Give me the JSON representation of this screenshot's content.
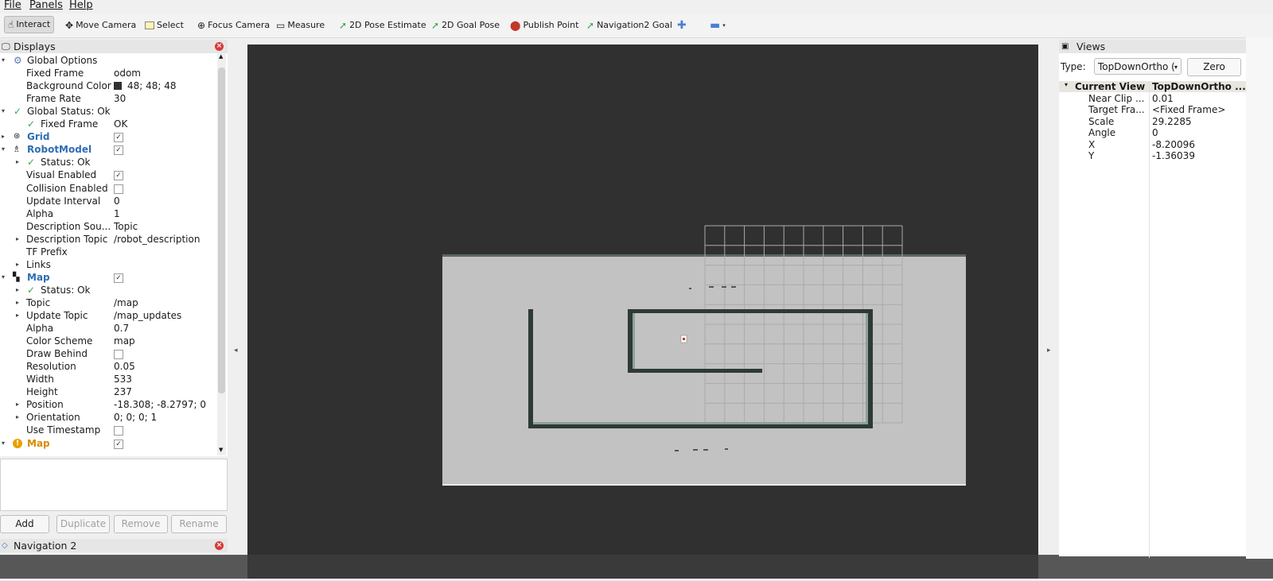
{
  "menu": [
    "File",
    "Panels",
    "Help"
  ],
  "toolbar": {
    "tools": [
      "Interact",
      "Move Camera",
      "Select",
      "Focus Camera",
      "Measure",
      "2D Pose Estimate",
      "2D Goal Pose",
      "Publish Point",
      "Navigation2 Goal"
    ]
  },
  "displays": {
    "title": "Displays",
    "rows": [
      {
        "name": "Global Options",
        "value": ""
      },
      {
        "name": "Fixed Frame",
        "value": "odom"
      },
      {
        "name": "Background Color",
        "value": "48; 48; 48"
      },
      {
        "name": "Frame Rate",
        "value": "30"
      },
      {
        "name": "Global Status: Ok",
        "value": ""
      },
      {
        "name": "Fixed Frame",
        "value": "OK"
      },
      {
        "name": "Grid",
        "value": ""
      },
      {
        "name": "RobotModel",
        "value": ""
      },
      {
        "name": "Status: Ok",
        "value": ""
      },
      {
        "name": "Visual Enabled",
        "value": ""
      },
      {
        "name": "Collision Enabled",
        "value": ""
      },
      {
        "name": "Update Interval",
        "value": "0"
      },
      {
        "name": "Alpha",
        "value": "1"
      },
      {
        "name": "Description Sou...",
        "value": "Topic"
      },
      {
        "name": "Description Topic",
        "value": "/robot_description"
      },
      {
        "name": "TF Prefix",
        "value": ""
      },
      {
        "name": "Links",
        "value": ""
      },
      {
        "name": "Map",
        "value": ""
      },
      {
        "name": "Status: Ok",
        "value": ""
      },
      {
        "name": "Topic",
        "value": "/map"
      },
      {
        "name": "Update Topic",
        "value": "/map_updates"
      },
      {
        "name": "Alpha",
        "value": "0.7"
      },
      {
        "name": "Color Scheme",
        "value": "map"
      },
      {
        "name": "Draw Behind",
        "value": ""
      },
      {
        "name": "Resolution",
        "value": "0.05"
      },
      {
        "name": "Width",
        "value": "533"
      },
      {
        "name": "Height",
        "value": "237"
      },
      {
        "name": "Position",
        "value": "-18.308; -8.2797; 0"
      },
      {
        "name": "Orientation",
        "value": "0; 0; 0; 1"
      },
      {
        "name": "Use Timestamp",
        "value": ""
      },
      {
        "name": "Map",
        "value": ""
      }
    ],
    "buttons": {
      "add": "Add",
      "duplicate": "Duplicate",
      "remove": "Remove",
      "rename": "Rename"
    }
  },
  "navigation": {
    "title": "Navigation 2"
  },
  "views": {
    "title": "Views",
    "type_label": "Type:",
    "type_value": "TopDownOrtho (",
    "zero": "Zero",
    "current_view": "Current View",
    "current_view_value": "TopDownOrtho ...",
    "props": [
      {
        "k": "Near Clip ...",
        "v": "0.01"
      },
      {
        "k": "Target Fra...",
        "v": "<Fixed Frame>"
      },
      {
        "k": "Scale",
        "v": "29.2285"
      },
      {
        "k": "Angle",
        "v": "0"
      },
      {
        "k": "X",
        "v": "-8.20096"
      },
      {
        "k": "Y",
        "v": "-1.36039"
      }
    ]
  },
  "colors": {
    "background": "#303030",
    "map_free": "#c2c2c2",
    "wall": "#2e3a36",
    "link_blue": "#2e6db4",
    "warn_orange": "#d88a00"
  }
}
